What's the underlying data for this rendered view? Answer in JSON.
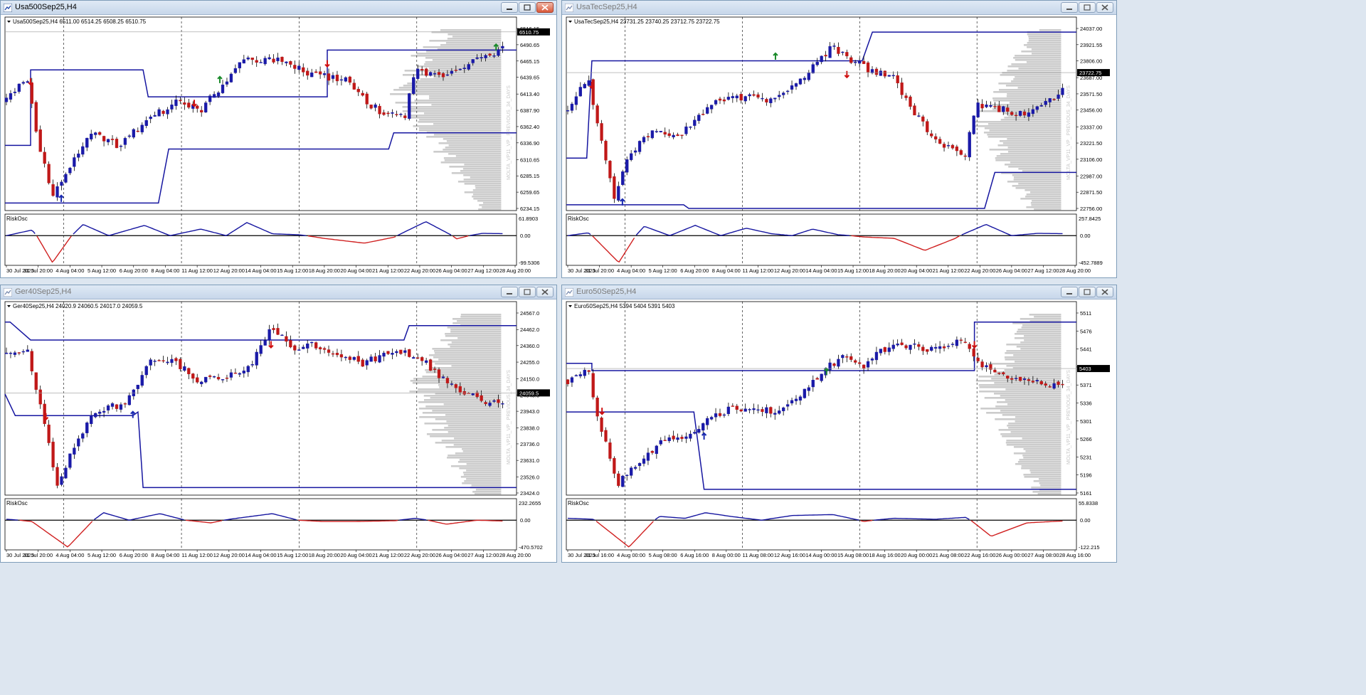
{
  "colors": {
    "bull": "#1a1aa8",
    "bear": "#c01818",
    "line": "#1616a0",
    "osc_up": "#1616a0",
    "osc_down": "#d02020",
    "profile": "#cccccc",
    "grid": "#000000",
    "text": "#000000"
  },
  "windows": [
    {
      "key": "w0",
      "title": "Usa500Sep25,H4",
      "active": true,
      "header": "Usa500Sep25,H4  6511.00 6514.25 6508.25 6510.75",
      "price_ticks": [
        "6516.15",
        "6490.65",
        "6465.15",
        "6439.65",
        "6413.40",
        "6387.90",
        "6362.40",
        "6336.90",
        "6310.65",
        "6285.15",
        "6259.65",
        "6234.15"
      ],
      "price_range": [
        6234.15,
        6516.15
      ],
      "current_price": "6510.75",
      "osc_label": "RiskOsc",
      "osc_ticks": [
        "61.8903",
        "0.00",
        "-99.5306"
      ],
      "vp_label": "MOLTA_VP11_VP_ PREVIOUS_34_DAYS",
      "time_labels": [
        "30 Jul 2025",
        "31 Jul 20:00",
        "4 Aug 04:00",
        "5 Aug 12:00",
        "6 Aug 20:00",
        "8 Aug 04:00",
        "11 Aug 12:00",
        "12 Aug 20:00",
        "14 Aug 04:00",
        "15 Aug 12:00",
        "18 Aug 20:00",
        "20 Aug 04:00",
        "21 Aug 12:00",
        "22 Aug 20:00",
        "26 Aug 04:00",
        "27 Aug 12:00",
        "28 Aug 20:00"
      ]
    },
    {
      "key": "w1",
      "title": "UsaTecSep25,H4",
      "active": false,
      "header": "UsaTecSep25,H4  23731.25 23740.25 23712.75 23722.75",
      "price_ticks": [
        "24037.00",
        "23921.55",
        "23806.00",
        "23687.00",
        "23571.50",
        "23456.00",
        "23337.00",
        "23221.50",
        "23106.00",
        "22987.00",
        "22871.50",
        "22756.00"
      ],
      "price_range": [
        22756.0,
        24037.0
      ],
      "current_price": "23722.75",
      "osc_label": "RiskOsc",
      "osc_ticks": [
        "257.8425",
        "0.00",
        "-452.7889"
      ],
      "vp_label": "MOLTA_VP11_VP_ PREVIOUS_34_DAYS",
      "time_labels": [
        "30 Jul 2025",
        "31 Jul 20:00",
        "4 Aug 04:00",
        "5 Aug 12:00",
        "6 Aug 20:00",
        "8 Aug 04:00",
        "11 Aug 12:00",
        "12 Aug 20:00",
        "14 Aug 04:00",
        "15 Aug 12:00",
        "18 Aug 20:00",
        "20 Aug 04:00",
        "21 Aug 12:00",
        "22 Aug 20:00",
        "26 Aug 04:00",
        "27 Aug 12:00",
        "28 Aug 20:00"
      ]
    },
    {
      "key": "w2",
      "title": "Ger40Sep25,H4",
      "active": false,
      "header": "Ger40Sep25,H4  24020.9 24060.5 24017.0 24059.5",
      "price_ticks": [
        "24567.0",
        "24462.0",
        "24360.0",
        "24255.0",
        "24150.0",
        "24045.0",
        "23943.0",
        "23838.0",
        "23736.0",
        "23631.0",
        "23526.0",
        "23424.0"
      ],
      "price_range": [
        23424.0,
        24567.0
      ],
      "current_price": "24059.5",
      "osc_label": "RiskOsc",
      "osc_ticks": [
        "232.2655",
        "0.00",
        "-470.5702"
      ],
      "vp_label": "MOLTA_VP11_VP_ PREVIOUS_34_DAYS",
      "time_labels": [
        "30 Jul 2025",
        "31 Jul 20:00",
        "4 Aug 04:00",
        "5 Aug 12:00",
        "6 Aug 20:00",
        "8 Aug 04:00",
        "11 Aug 12:00",
        "12 Aug 20:00",
        "14 Aug 04:00",
        "15 Aug 12:00",
        "18 Aug 20:00",
        "20 Aug 04:00",
        "21 Aug 12:00",
        "22 Aug 20:00",
        "26 Aug 04:00",
        "27 Aug 12:00",
        "28 Aug 20:00"
      ]
    },
    {
      "key": "w3",
      "title": "Euro50Sep25,H4",
      "active": false,
      "header": "Euro50Sep25,H4  5394 5404 5391 5403",
      "price_ticks": [
        "5511",
        "5476",
        "5441",
        "5406",
        "5371",
        "5336",
        "5301",
        "5266",
        "5231",
        "5196",
        "5161"
      ],
      "price_range": [
        5161,
        5511
      ],
      "current_price": "5403",
      "osc_label": "RiskOsc",
      "osc_ticks": [
        "55.8338",
        "0.00",
        "-122.215"
      ],
      "vp_label": "MOLTA_VP11_VP_ PREVIOUS_34_DAYS",
      "time_labels": [
        "30 Jul 2025",
        "31 Jul 16:00",
        "4 Aug 00:00",
        "5 Aug 08:00",
        "6 Aug 16:00",
        "8 Aug 00:00",
        "11 Aug 08:00",
        "12 Aug 16:00",
        "14 Aug 00:00",
        "15 Aug 08:00",
        "18 Aug 16:00",
        "20 Aug 00:00",
        "21 Aug 08:00",
        "22 Aug 16:00",
        "26 Aug 00:00",
        "27 Aug 08:00",
        "28 Aug 16:00"
      ]
    }
  ]
}
